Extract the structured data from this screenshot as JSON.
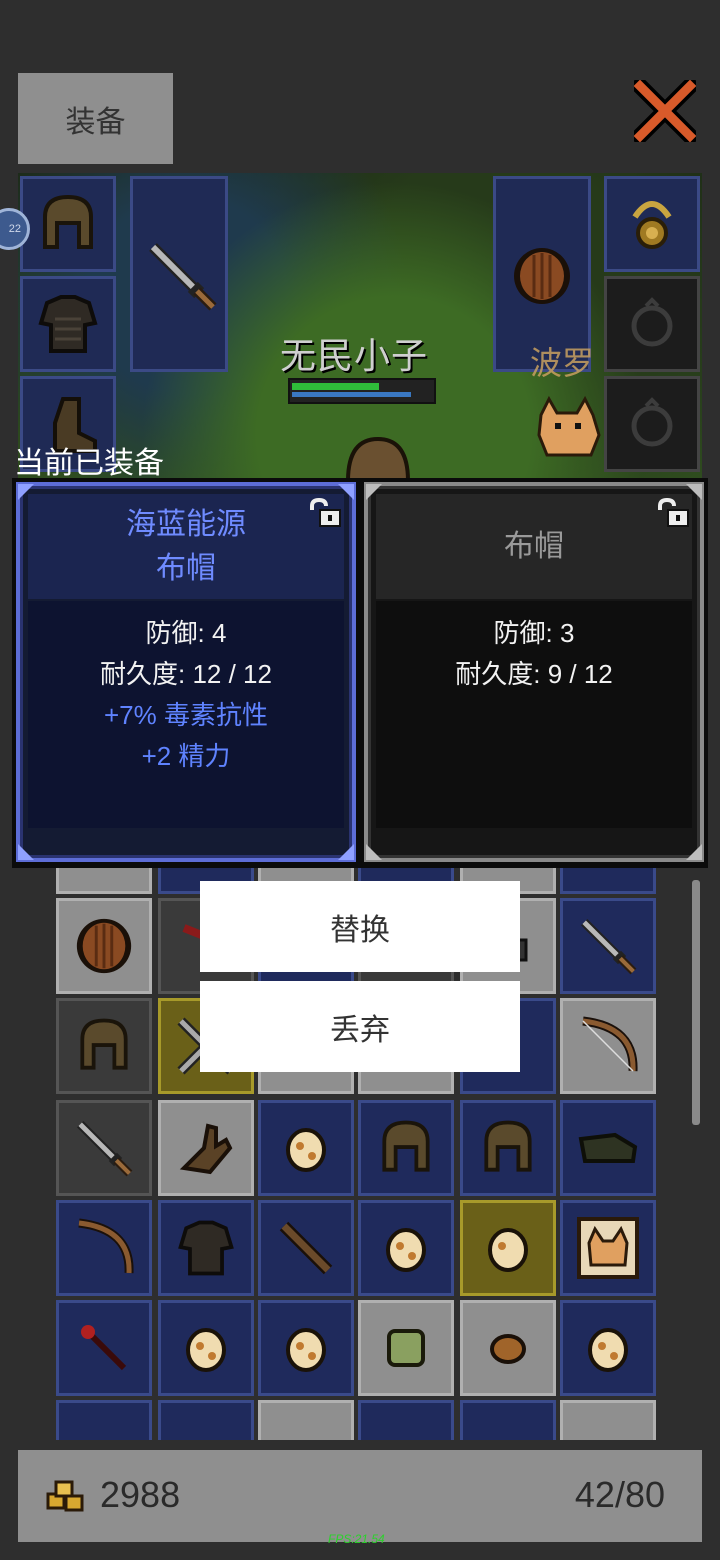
{
  "header": {
    "tab_label": "装备",
    "close_icon": "close-x-icon"
  },
  "scene": {
    "character_name": "无民小子",
    "pet_name": "波罗",
    "hp_fraction": 0.62,
    "mana_fraction": 0.85,
    "side_badge": "22",
    "equip_slots_left": [
      "helmet-icon",
      "armor-icon",
      "boots-icon"
    ],
    "weapon_slot": "sword-icon",
    "offhand_slot": "shield-icon",
    "equip_slots_right": [
      "amulet-icon",
      "empty-ring-icon",
      "empty-ring-icon"
    ]
  },
  "compare": {
    "section_label": "当前已装备",
    "current": {
      "name_line1": "海蓝能源",
      "name_line2": "布帽",
      "stat_defense": "防御: 4",
      "stat_durability": "耐久度: 12 / 12",
      "bonus1": "+7% 毒素抗性",
      "bonus2": "+2 精力",
      "lock_icon": "unlock-icon"
    },
    "candidate": {
      "name": "布帽",
      "stat_defense": "防御: 3",
      "stat_durability": "耐久度: 9 / 12",
      "lock_icon": "unlock-icon"
    }
  },
  "menu": {
    "replace_label": "替换",
    "discard_label": "丢弃"
  },
  "inventory": {
    "items": [
      "shield-icon",
      "dagger-icon",
      "chest-icon",
      "sword-icon",
      "helmet-icon",
      "crossed-swords-icon",
      "bow-icon",
      "sword-icon",
      "glove-icon",
      "egg-icon",
      "helmet-icon",
      "helmet-icon",
      "boot-icon",
      "bow-icon",
      "armor-icon",
      "club-icon",
      "egg-icon",
      "egg-icon",
      "cat-card-icon",
      "wand-icon",
      "egg-icon",
      "egg-icon",
      "slime-icon",
      "rock-icon",
      "egg-icon"
    ]
  },
  "footer": {
    "gold_icon": "gold-coins-icon",
    "gold_amount": "2988",
    "capacity": "42/80"
  },
  "debug": {
    "fps": "FPS:21.54"
  }
}
